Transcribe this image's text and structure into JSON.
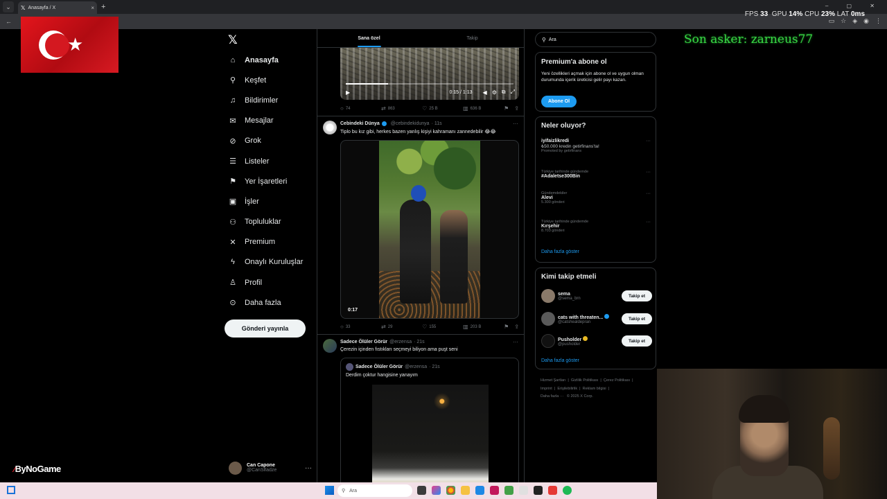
{
  "browser": {
    "tab_title": "Anasayfa / X",
    "tab_close": "×",
    "new_tab": "+"
  },
  "overlay": {
    "fps_label": "FPS",
    "fps_value": "33",
    "gpu_label": "GPU",
    "gpu_value": "14",
    "cpu_label": "CPU",
    "cpu_value": "23",
    "lat_label": "LAT",
    "lat_value": "0",
    "unit_percent": "%",
    "unit_ms": "ms"
  },
  "streamer_text": "Son asker: zarneus77",
  "brand_watermark": {
    "by": "By",
    "no": "No",
    "game": "Game"
  },
  "nav": {
    "items": [
      {
        "label": "Anasayfa",
        "icon": "home-icon",
        "glyph": "⌂",
        "active": true
      },
      {
        "label": "Keşfet",
        "icon": "search-icon",
        "glyph": "⚲"
      },
      {
        "label": "Bildirimler",
        "icon": "bell-icon",
        "glyph": "♫"
      },
      {
        "label": "Mesajlar",
        "icon": "envelope-icon",
        "glyph": "✉"
      },
      {
        "label": "Grok",
        "icon": "grok-icon",
        "glyph": "⊘"
      },
      {
        "label": "Listeler",
        "icon": "list-icon",
        "glyph": "☰"
      },
      {
        "label": "Yer İşaretleri",
        "icon": "bookmark-icon",
        "glyph": "⚑"
      },
      {
        "label": "İşler",
        "icon": "briefcase-icon",
        "glyph": "▣"
      },
      {
        "label": "Topluluklar",
        "icon": "communities-icon",
        "glyph": "⚇"
      },
      {
        "label": "Premium",
        "icon": "x-icon",
        "glyph": "✕"
      },
      {
        "label": "Onaylı Kuruluşlar",
        "icon": "lightning-icon",
        "glyph": "ϟ"
      },
      {
        "label": "Profil",
        "icon": "person-icon",
        "glyph": "♙"
      },
      {
        "label": "Daha fazla",
        "icon": "more-circle-icon",
        "glyph": "⊙"
      }
    ],
    "post_button": "Gönderi yayınla"
  },
  "account": {
    "name": "Can Capone",
    "handle": "@CanSlfadze",
    "more": "···"
  },
  "feed": {
    "tabs": [
      "Sana özel",
      "Takip"
    ],
    "video1": {
      "time": "0:15 / 1:13",
      "progress": 0.25
    },
    "post0_actions": {
      "replies": "74",
      "reposts": "863",
      "likes": "25 B",
      "views": "636 B"
    },
    "post1": {
      "name": "Cebindeki Dünya",
      "handle": "@cebindekidunya",
      "time": "· 11s",
      "text": "Tiplo bu kız gibi, herkes bazen yanlış kişiyi kahramanı zannedebilir 😂😂",
      "video_duration": "0:17",
      "actions": {
        "replies": "33",
        "reposts": "29",
        "likes": "155",
        "views": "203 B"
      }
    },
    "post2": {
      "name": "Sadece Ölüler Görür",
      "handle": "@erzensa",
      "time": "· 21s",
      "text": "Çerezin içinden fıstıkları seçmeyi biliyon ama puşt seni",
      "quote": {
        "name": "Sadece Ölüler Görür",
        "handle": "@erzensa",
        "time": "· 21s",
        "text": "Derdim çoktur hangisine yanayım"
      }
    }
  },
  "sidebar": {
    "search_placeholder": "Ara",
    "premium": {
      "title": "Premium'a abone ol",
      "text": "Yeni özellikleri açmak için abone ol ve uygun olman durumunda içerik üreticisi gelir payı kazan.",
      "button": "Abone Ol"
    },
    "trends": {
      "title": "Neler oluyor?",
      "items": [
        {
          "category": "",
          "title": "iyifaizlikredi",
          "count": "₺50.000 kredin getirfinans'ta!",
          "promo": "Promoted by getirfinans"
        },
        {
          "category": "Türkiye tarihinde gündemde",
          "title": "#Adaletse300Bin",
          "count": ""
        },
        {
          "category": "Gündemdekiler",
          "title": "Alevi",
          "count": "5.300 gönderi"
        },
        {
          "category": "Türkiye tarihinde gündemde",
          "title": "Kırşehir",
          "count": "8.703 gönderi"
        }
      ],
      "show_more": "Daha fazla göster"
    },
    "who_to_follow": {
      "title": "Kimi takip etmeli",
      "items": [
        {
          "name": "sema",
          "handle": "@sema_brn",
          "verified": false,
          "button": "Takip et",
          "color": "#8a7a6a"
        },
        {
          "name": "cats with threaten...",
          "handle": "@catshealdepran",
          "verified": true,
          "button": "Takip et",
          "color": "#5a5a5a"
        },
        {
          "name": "Pusholder",
          "handle": "@pusholder",
          "verified": true,
          "button": "Takip et",
          "color": "#111111"
        }
      ],
      "show_more": "Daha fazla göster"
    },
    "footer": [
      "Hizmet Şartları",
      "Gizlilik Politikası",
      "Çerez Politikası",
      "Imprint",
      "Erişilebilirlik",
      "Reklam bilgisi",
      "Daha fazla ···",
      "© 2025 X Corp."
    ]
  },
  "taskbar": {
    "search_placeholder": "Ara"
  },
  "colors": {
    "accent": "#1d9bf0",
    "streamer_green": "#38d645"
  }
}
